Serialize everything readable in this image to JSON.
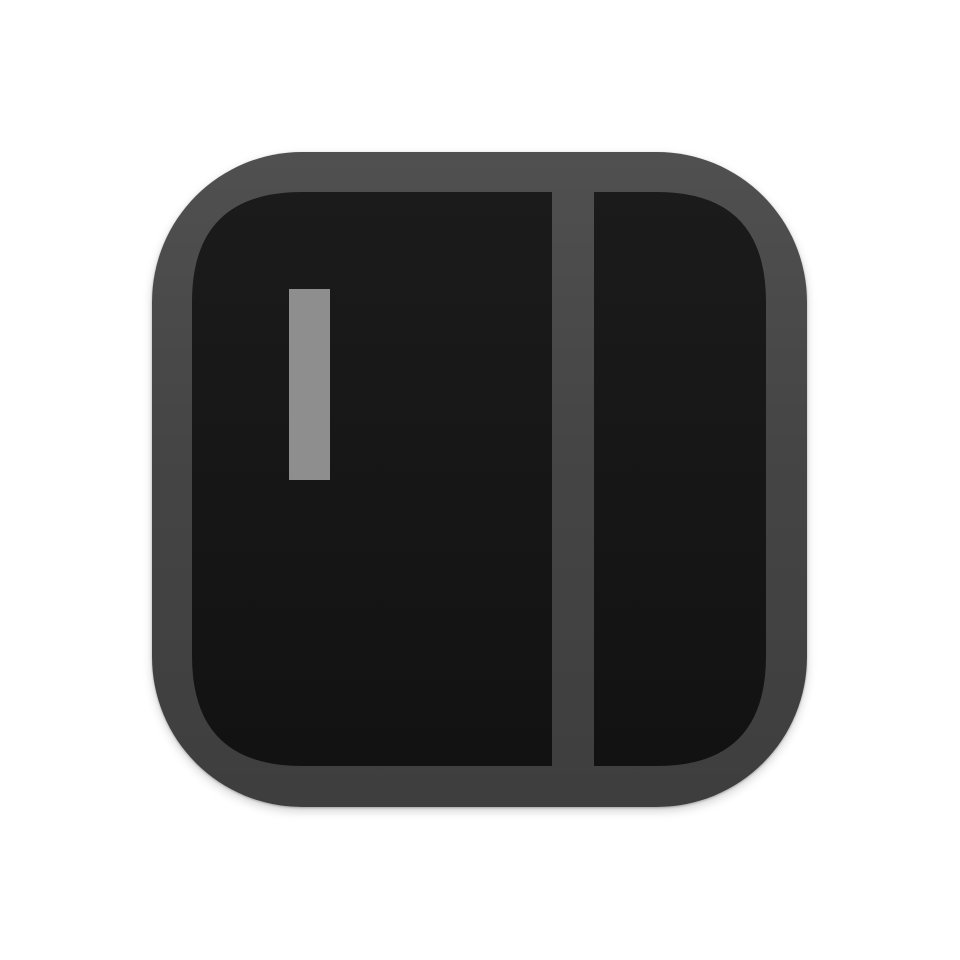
{
  "icon": {
    "name": "split-panel-app-icon",
    "colors": {
      "background": "#ffffff",
      "frame": "#4a4a4a",
      "panel": "#171717",
      "indicator": "#8e8e8e"
    }
  }
}
